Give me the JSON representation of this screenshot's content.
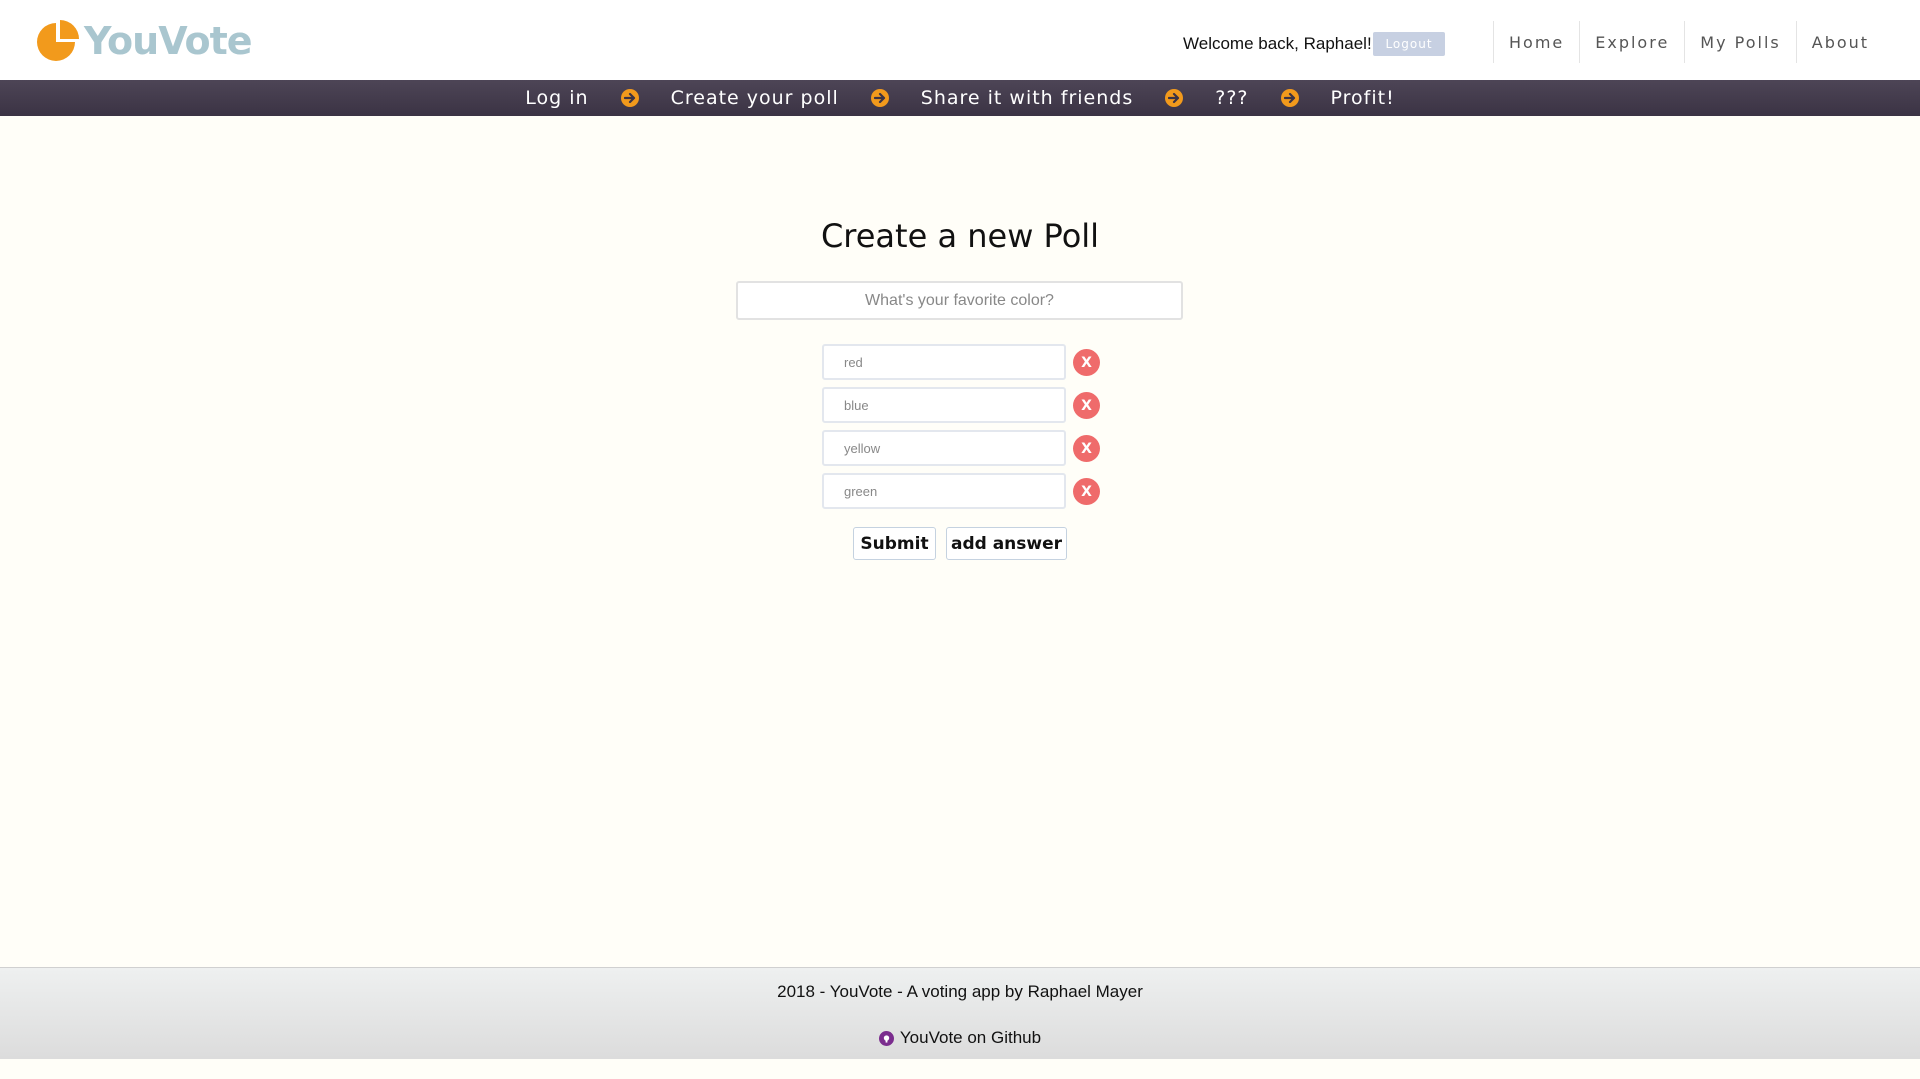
{
  "brand": {
    "name": "YouVote",
    "logo_icon": "pie-chart-logo-icon",
    "logo_color": "#f29a1c",
    "text_color": "#a9c6cf"
  },
  "header": {
    "welcome": "Welcome back, Raphael!",
    "logout_label": "Logout",
    "nav": [
      {
        "label": "Home"
      },
      {
        "label": "Explore"
      },
      {
        "label": "My Polls"
      },
      {
        "label": "About"
      }
    ]
  },
  "steps": {
    "items": [
      "Log in",
      "Create your poll",
      "Share it with friends",
      "???",
      "Profit!"
    ],
    "arrow_icon": "arrow-right-circle-icon",
    "arrow_color": "#f29a1c",
    "bar_color": "#443c4d"
  },
  "main": {
    "title": "Create a new Poll",
    "question_placeholder": "What's your favorite color?",
    "answers": [
      {
        "placeholder": "red",
        "remove_label": "X"
      },
      {
        "placeholder": "blue",
        "remove_label": "X"
      },
      {
        "placeholder": "yellow",
        "remove_label": "X"
      },
      {
        "placeholder": "green",
        "remove_label": "X"
      }
    ],
    "submit_label": "Submit",
    "add_answer_label": "add answer",
    "remove_color": "#ef6b6b"
  },
  "footer": {
    "text": "2018 - YouVote - A voting app by Raphael Mayer",
    "github_label": "YouVote on Github",
    "github_icon": "github-icon"
  }
}
